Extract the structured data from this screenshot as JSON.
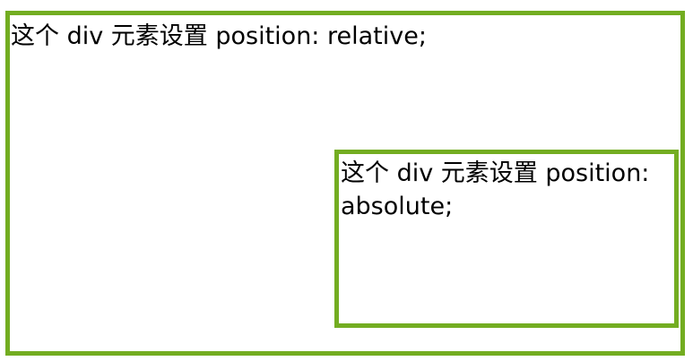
{
  "relative_box": {
    "text": "这个 div 元素设置 position: relative;",
    "border_color": "#73AD21"
  },
  "absolute_box": {
    "text": "这个 div 元素设置 position: absolute;",
    "border_color": "#73AD21"
  }
}
